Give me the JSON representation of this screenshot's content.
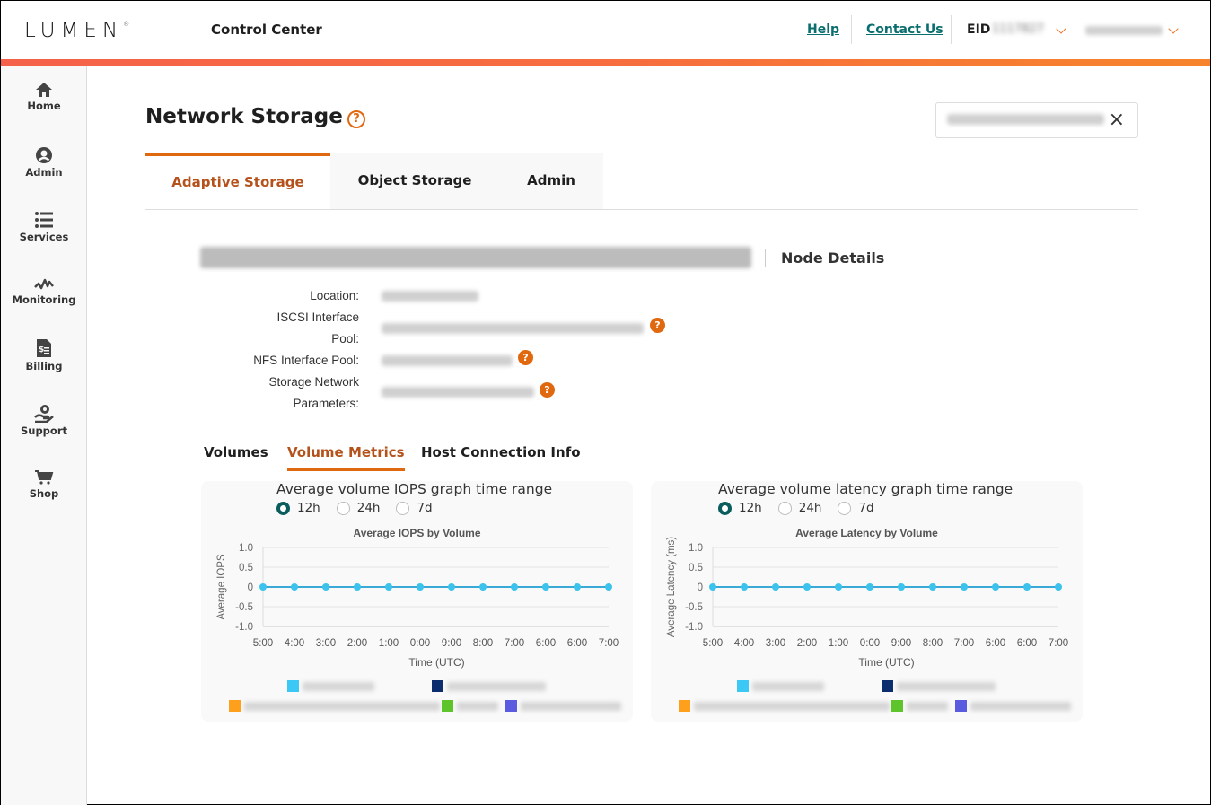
{
  "header": {
    "logo": "LUMEN",
    "logo_mark": "®",
    "app_title": "Control Center",
    "links": [
      "Help",
      "Contact Us"
    ],
    "eid_label": "EID",
    "eid_value": "1117827",
    "user_name": "redacted user"
  },
  "sidebar": {
    "items": [
      {
        "label": "Home",
        "icon": "home-icon"
      },
      {
        "label": "Admin",
        "icon": "user-circle-icon"
      },
      {
        "label": "Services",
        "icon": "list-icon"
      },
      {
        "label": "Monitoring",
        "icon": "pulse-icon"
      },
      {
        "label": "Billing",
        "icon": "invoice-icon"
      },
      {
        "label": "Support",
        "icon": "support-hand-icon"
      },
      {
        "label": "Shop",
        "icon": "cart-icon"
      }
    ]
  },
  "page": {
    "title": "Network Storage",
    "help_icon": "?",
    "search_value": "redacted search value",
    "clear_icon": "×",
    "tabs": [
      {
        "label": "Adaptive Storage",
        "active": true
      },
      {
        "label": "Object Storage",
        "active": false
      },
      {
        "label": "Admin",
        "active": false
      }
    ]
  },
  "node": {
    "name": "redacted node name",
    "section_title": "Node Details",
    "details": [
      {
        "label_lines": [
          "Location:"
        ],
        "value": "redacted",
        "help": false
      },
      {
        "label_lines": [
          "ISCSI Interface",
          "Pool:"
        ],
        "value": "redacted",
        "help": true
      },
      {
        "label_lines": [
          "NFS Interface Pool:"
        ],
        "value": "redacted",
        "help": true
      },
      {
        "label_lines": [
          "Storage Network",
          "Parameters:"
        ],
        "value": "redacted",
        "help": true
      }
    ],
    "help_glyph": "?"
  },
  "subtabs": [
    {
      "label": "Volumes",
      "active": false
    },
    {
      "label": "Volume Metrics",
      "active": true
    },
    {
      "label": "Host Connection Info",
      "active": false
    }
  ],
  "panels": [
    {
      "range_title": "Average volume IOPS graph time range",
      "options": [
        {
          "label": "12h",
          "selected": true
        },
        {
          "label": "24h",
          "selected": false
        },
        {
          "label": "7d",
          "selected": false
        }
      ]
    },
    {
      "range_title": "Average volume latency graph time range",
      "options": [
        {
          "label": "12h",
          "selected": true
        },
        {
          "label": "24h",
          "selected": false
        },
        {
          "label": "7d",
          "selected": false
        }
      ]
    }
  ],
  "colors": {
    "accent_orange": "#e0680f",
    "active_tab_text": "#b5521b",
    "link_teal": "#0b6e6e",
    "radio_selected": "#0b5c5c",
    "series_line": "#3aa9d6",
    "series_point": "#3bc3ee"
  },
  "chart_data": [
    {
      "type": "line",
      "title": "Average IOPS by Volume",
      "xlabel": "Time (UTC)",
      "ylabel": "Average IOPS",
      "ylim": [
        -1.0,
        1.0
      ],
      "yticks": [
        "1.0",
        "0.5",
        "0",
        "-0.5",
        "-1.0"
      ],
      "categories": [
        "5:00",
        "4:00",
        "3:00",
        "2:00",
        "1:00",
        "0:00",
        "9:00",
        "8:00",
        "7:00",
        "6:00",
        "6:00",
        "7:00"
      ],
      "grid": true,
      "legend_position": "bottom",
      "series": [
        {
          "name": "redacted volume 1",
          "color": "#3bc8f5",
          "values": [
            0,
            0,
            0,
            0,
            0,
            0,
            0,
            0,
            0,
            0,
            0,
            0
          ]
        },
        {
          "name": "redacted volume 2",
          "color": "#0b2d6e",
          "values": [
            0,
            0,
            0,
            0,
            0,
            0,
            0,
            0,
            0,
            0,
            0,
            0
          ]
        },
        {
          "name": "redacted volume 3",
          "color": "#ffa01c",
          "values": [
            0,
            0,
            0,
            0,
            0,
            0,
            0,
            0,
            0,
            0,
            0,
            0
          ]
        },
        {
          "name": "redacted volume 4",
          "color": "#5ec42b",
          "values": [
            0,
            0,
            0,
            0,
            0,
            0,
            0,
            0,
            0,
            0,
            0,
            0
          ]
        },
        {
          "name": "redacted volume 5",
          "color": "#5b5be0",
          "values": [
            0,
            0,
            0,
            0,
            0,
            0,
            0,
            0,
            0,
            0,
            0,
            0
          ]
        }
      ]
    },
    {
      "type": "line",
      "title": "Average Latency by Volume",
      "xlabel": "Time (UTC)",
      "ylabel": "Average Latency (ms)",
      "ylim": [
        -1.0,
        1.0
      ],
      "yticks": [
        "1.0",
        "0.5",
        "0",
        "-0.5",
        "-1.0"
      ],
      "categories": [
        "5:00",
        "4:00",
        "3:00",
        "2:00",
        "1:00",
        "0:00",
        "9:00",
        "8:00",
        "7:00",
        "6:00",
        "6:00",
        "7:00"
      ],
      "grid": true,
      "legend_position": "bottom",
      "series": [
        {
          "name": "redacted volume 1",
          "color": "#3bc8f5",
          "values": [
            0,
            0,
            0,
            0,
            0,
            0,
            0,
            0,
            0,
            0,
            0,
            0
          ]
        },
        {
          "name": "redacted volume 2",
          "color": "#0b2d6e",
          "values": [
            0,
            0,
            0,
            0,
            0,
            0,
            0,
            0,
            0,
            0,
            0,
            0
          ]
        },
        {
          "name": "redacted volume 3",
          "color": "#ffa01c",
          "values": [
            0,
            0,
            0,
            0,
            0,
            0,
            0,
            0,
            0,
            0,
            0,
            0
          ]
        },
        {
          "name": "redacted volume 4",
          "color": "#5ec42b",
          "values": [
            0,
            0,
            0,
            0,
            0,
            0,
            0,
            0,
            0,
            0,
            0,
            0
          ]
        },
        {
          "name": "redacted volume 5",
          "color": "#5b5be0",
          "values": [
            0,
            0,
            0,
            0,
            0,
            0,
            0,
            0,
            0,
            0,
            0,
            0
          ]
        }
      ]
    }
  ]
}
